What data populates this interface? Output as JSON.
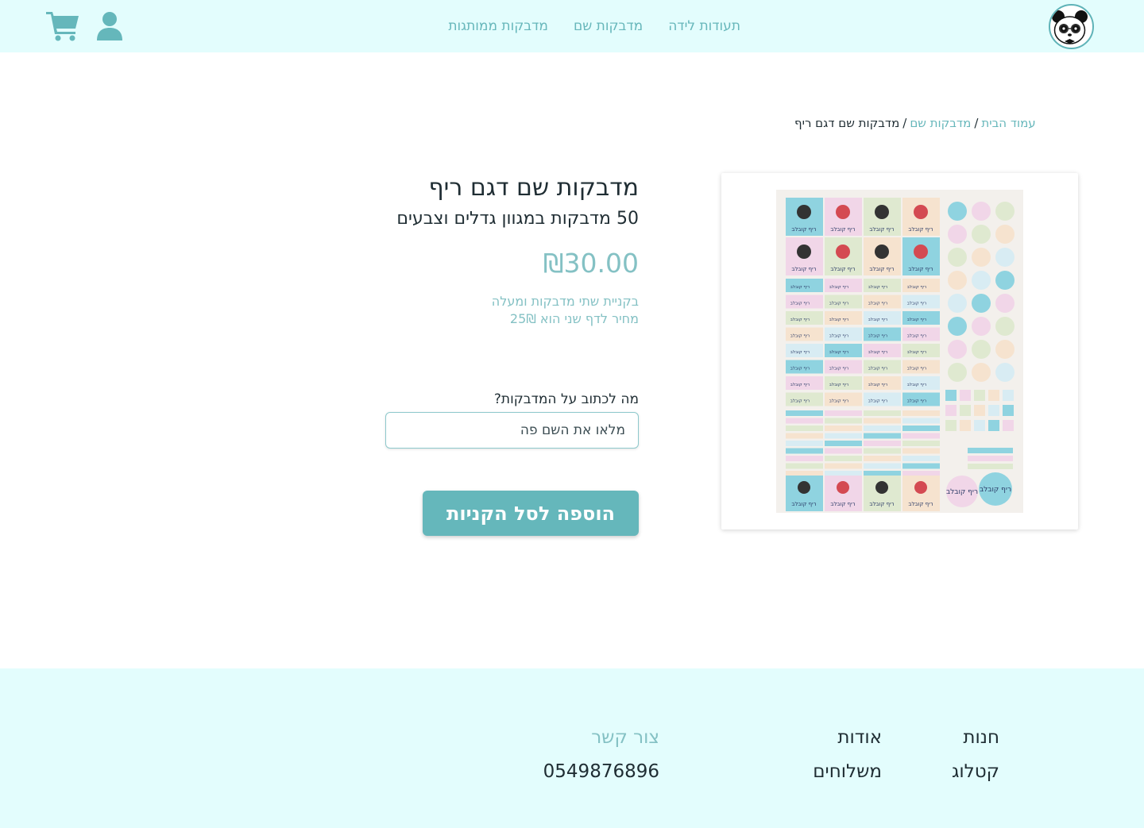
{
  "header": {
    "nav": [
      "תעודות לידה",
      "מדבקות שם",
      "מדבקות ממותגות"
    ],
    "icons": [
      "panda-logo",
      "user-icon",
      "cart-icon"
    ]
  },
  "breadcrumb": {
    "home": "עמוד הבית",
    "category": "מדבקות שם",
    "current": "מדבקות שם דגם ריף",
    "separator": "/"
  },
  "product": {
    "title": "מדבקות שם דגם ריף",
    "subtitle": "50 מדבקות במגוון גדלים וצבעים",
    "price": "₪30.00",
    "note_line1": "בקניית שתי מדבקות ומעלה",
    "note_line2": "מחיר לדף שני הוא 25₪",
    "field_label": "מה לכתוב על המדבקות?",
    "input_placeholder": "מלאו את השם פה",
    "input_value": "",
    "add_button": "הוספה לסל הקניות",
    "sheet_text": "ריף קובלב"
  },
  "footer": {
    "col1": [
      "חנות",
      "קטלוג"
    ],
    "col2": [
      "אודות",
      "משלוחים"
    ],
    "col3": [
      "צור קשר",
      "0549876896"
    ]
  },
  "colors": {
    "accent": "#65b7bb",
    "header_bg": "#e3fdfd",
    "muted": "#84c1c4",
    "text": "#1f2d33"
  }
}
